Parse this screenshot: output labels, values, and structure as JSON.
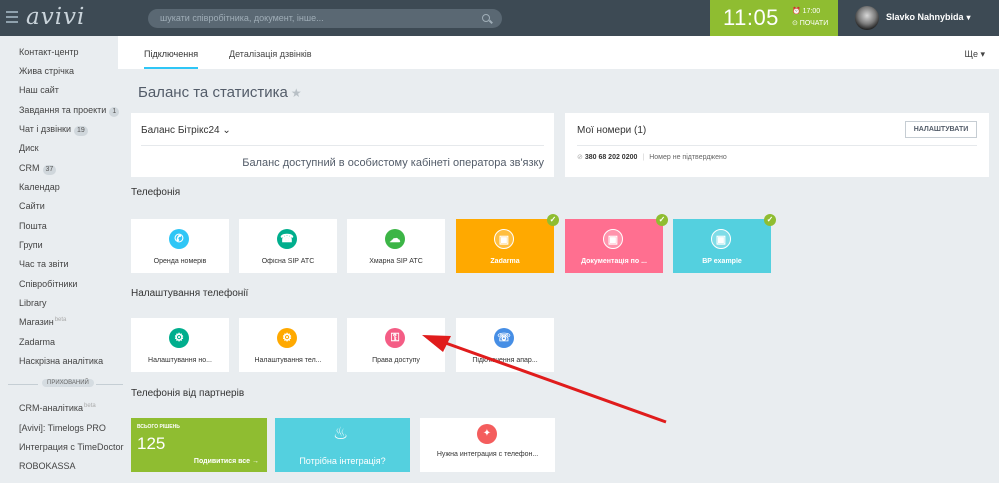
{
  "topbar": {
    "logo": "avivi",
    "search_placeholder": "шукати співробітника, документ, інше...",
    "clock": "11:05",
    "alarm": "⏰ 17:00",
    "start_label": "⊙ ПОЧАТИ",
    "user_name": "Slavko Nahnybida",
    "colors": {
      "bar": "#3d4a54",
      "clock": "#8fbd31"
    }
  },
  "sidebar": {
    "items": [
      {
        "label": "Контакт-центр"
      },
      {
        "label": "Жива стрічка"
      },
      {
        "label": "Наш сайт"
      },
      {
        "label": "Завдання та проекти",
        "count": "1"
      },
      {
        "label": "Чат і дзвінки",
        "count": "19"
      },
      {
        "label": "Диск"
      },
      {
        "label": "CRM",
        "count": "37"
      },
      {
        "label": "Календар"
      },
      {
        "label": "Сайти"
      },
      {
        "label": "Пошта"
      },
      {
        "label": "Групи"
      },
      {
        "label": "Час та звіти"
      },
      {
        "label": "Співробітники"
      },
      {
        "label": "Library"
      },
      {
        "label": "Магазин",
        "beta": "beta"
      },
      {
        "label": "Zadarma"
      },
      {
        "label": "Наскрізна аналітика"
      }
    ],
    "hidden_label": "ПРИХОВАНИЙ",
    "hidden_items": [
      {
        "label": "CRM-аналітика",
        "beta": "beta"
      },
      {
        "label": "[Avivi]: Timelogs PRO"
      },
      {
        "label": "Интеграция с TimeDoctor"
      },
      {
        "label": "ROBOKASSA"
      }
    ]
  },
  "tabs": {
    "items": [
      "Підключення",
      "Деталізація дзвінків"
    ],
    "more": "Ще"
  },
  "page": {
    "title": "Баланс та статистика"
  },
  "balance": {
    "head": "Баланс Бітрікс24",
    "message": "Баланс доступний в особистому кабінеті оператора зв'язку"
  },
  "numbers": {
    "head": "Мої номери (1)",
    "setup_button": "НАЛАШТУВАТИ",
    "phone": "380 68 202 0200",
    "status": "Номер не підтверджено"
  },
  "sections": {
    "telephony": "Телефонія",
    "telephony_settings": "Налаштування телефонії",
    "partners": "Телефонія від партнерів"
  },
  "telephony_tiles": [
    {
      "label": "Оренда номерів",
      "icon": "phone-rent-icon",
      "icon_color": "#2fc6f6",
      "bg": "#ffffff"
    },
    {
      "label": "Офісна SIP АТС",
      "icon": "office-pbx-icon",
      "icon_color": "#00ae8d",
      "bg": "#ffffff"
    },
    {
      "label": "Хмарна SIP АТС",
      "icon": "cloud-pbx-icon",
      "icon_color": "#3cb546",
      "bg": "#ffffff"
    },
    {
      "label": "Zadarma",
      "icon": "box-icon",
      "bg": "#ffa900",
      "checked": true
    },
    {
      "label": "Документація по ...",
      "icon": "box-icon",
      "bg": "#ff6f90",
      "checked": true
    },
    {
      "label": "BP example",
      "icon": "box-icon",
      "bg": "#54d0df",
      "checked": true
    }
  ],
  "settings_tiles": [
    {
      "label": "Налаштування но...",
      "icon": "number-settings-icon",
      "icon_color": "#00ae8d"
    },
    {
      "label": "Налаштування тел...",
      "icon": "user-settings-icon",
      "icon_color": "#ffa900"
    },
    {
      "label": "Права доступу",
      "icon": "access-rights-icon",
      "icon_color": "#f45d85"
    },
    {
      "label": "Підключення апар...",
      "icon": "hardware-icon",
      "icon_color": "#468ee5"
    }
  ],
  "partner_tiles": {
    "total_label": "ВСЬОГО РІШЕНЬ",
    "total": "125",
    "see_all": "Подивитися все →",
    "need_integration": "Потрібна інтеграція?",
    "need_integration_phone": "Нужна интеграция с телефон...",
    "colors": {
      "total": "#8fbd31",
      "need": "#54d0df",
      "lamp": "#f45d5d"
    }
  },
  "annotation": {
    "color": "#e01c1c"
  }
}
